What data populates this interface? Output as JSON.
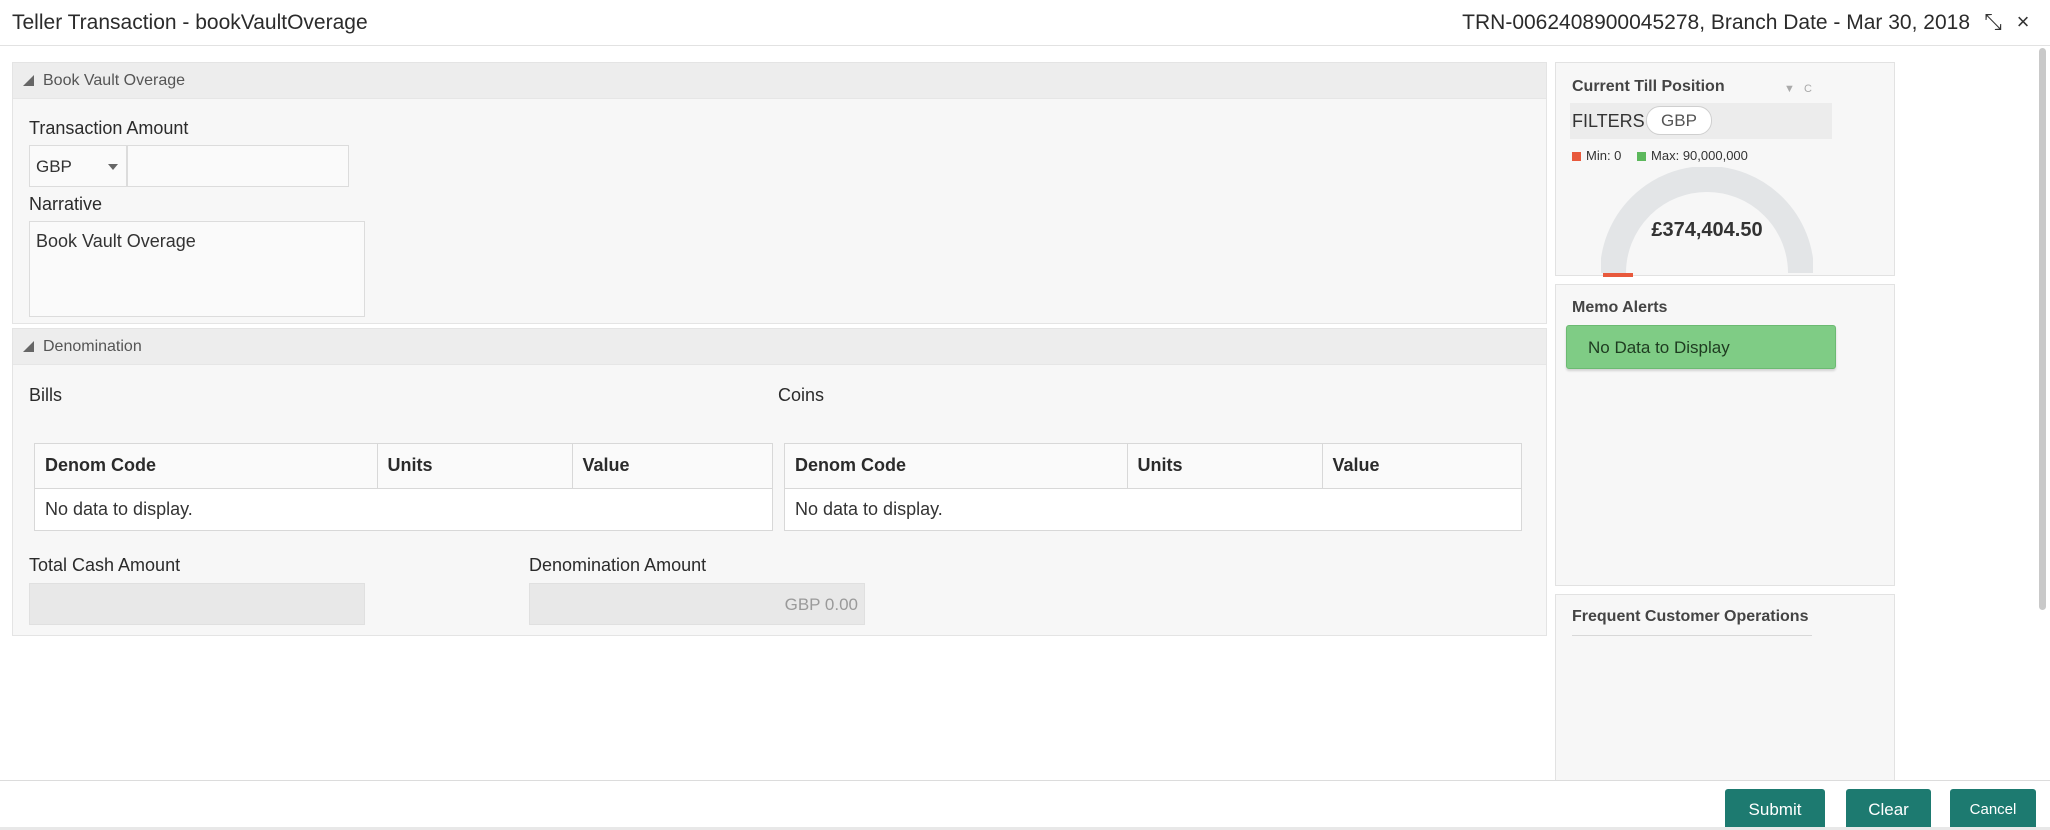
{
  "header": {
    "title": "Teller Transaction - bookVaultOverage",
    "reference": "TRN-0062408900045278, Branch Date - Mar 30, 2018",
    "minimize_glyph": "⤡",
    "close_glyph": "×"
  },
  "book_vault_overage": {
    "section_title": "Book Vault Overage",
    "transaction_amount_label": "Transaction Amount",
    "currency": "GBP",
    "amount_value": "",
    "narrative_label": "Narrative",
    "narrative_value": "Book Vault Overage"
  },
  "denomination": {
    "section_title": "Denomination",
    "bills": {
      "label": "Bills",
      "columns": [
        "Denom Code",
        "Units",
        "Value"
      ],
      "empty_text": "No data to display."
    },
    "coins": {
      "label": "Coins",
      "columns": [
        "Denom Code",
        "Units",
        "Value"
      ],
      "empty_text": "No data to display."
    },
    "total_cash_label": "Total Cash Amount",
    "total_cash_value": "",
    "denomination_amount_label": "Denomination Amount",
    "denomination_amount_value": "GBP 0.00"
  },
  "till_position": {
    "title": "Current Till Position",
    "filters_label": "FILTERS",
    "filter_chip": "GBP",
    "min_label": "Min: 0",
    "max_label": "Max: 90,000,000",
    "min": 0,
    "max": 90000000,
    "amount": 374404.5,
    "amount_text": "£374,404.50",
    "min_color": "#e8593c",
    "max_color": "#5cb85c"
  },
  "memo_alerts": {
    "title": "Memo Alerts",
    "empty_text": "No Data to Display"
  },
  "frequent_ops": {
    "title": "Frequent Customer Operations"
  },
  "footer": {
    "submit_label": "Submit",
    "clear_label": "Clear",
    "cancel_label": "Cancel"
  },
  "colors": {
    "primary_button": "#1d7a70",
    "memo_green": "#7fcc85"
  }
}
